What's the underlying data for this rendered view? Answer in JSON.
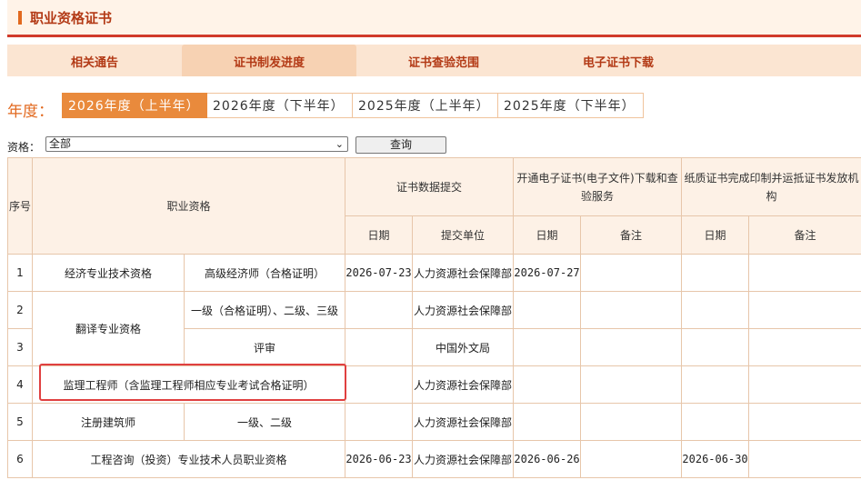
{
  "page": {
    "title": "职业资格证书"
  },
  "tabs": [
    {
      "label": "相关通告"
    },
    {
      "label": "证书制发进度"
    },
    {
      "label": "证书查验范围"
    },
    {
      "label": "电子证书下载"
    }
  ],
  "year": {
    "label": "年度：",
    "options": [
      {
        "label": "2026年度（上半年）"
      },
      {
        "label": "2026年度（下半年）"
      },
      {
        "label": "2025年度（上半年）"
      },
      {
        "label": "2025年度（下半年）"
      }
    ]
  },
  "filter": {
    "label": "资格：",
    "selected": "全部",
    "query_label": "查询"
  },
  "table": {
    "headers": {
      "seq": "序号",
      "qualification": "职业资格",
      "submission": "证书数据提交",
      "electronic": "开通电子证书(电子文件)下载和查验服务",
      "paper": "纸质证书完成印制并运抵证书发放机构",
      "date": "日期",
      "unit": "提交单位",
      "note": "备注"
    },
    "rows": [
      {
        "seq": "1",
        "group": "经济专业技术资格",
        "sub": "高级经济师（合格证明）",
        "submit_date": "2026-07-23",
        "unit": "人力资源社会保障部",
        "e_date": "2026-07-27",
        "e_note": "",
        "p_date": "",
        "p_note": ""
      },
      {
        "seq": "2",
        "group": "翻译专业资格",
        "sub": "一级（合格证明）、二级、三级",
        "submit_date": "",
        "unit": "人力资源社会保障部",
        "e_date": "",
        "e_note": "",
        "p_date": "",
        "p_note": ""
      },
      {
        "seq": "3",
        "sub": "评审",
        "submit_date": "",
        "unit": "中国外文局",
        "e_date": "",
        "e_note": "",
        "p_date": "",
        "p_note": ""
      },
      {
        "seq": "4",
        "full": "监理工程师（含监理工程师相应专业考试合格证明）",
        "submit_date": "",
        "unit": "人力资源社会保障部",
        "e_date": "",
        "e_note": "",
        "p_date": "",
        "p_note": ""
      },
      {
        "seq": "5",
        "group": "注册建筑师",
        "sub": "一级、二级",
        "submit_date": "",
        "unit": "人力资源社会保障部",
        "e_date": "",
        "e_note": "",
        "p_date": "",
        "p_note": ""
      },
      {
        "seq": "6",
        "full": "工程咨询（投资）专业技术人员职业资格",
        "submit_date": "2026-06-23",
        "unit": "人力资源社会保障部",
        "e_date": "2026-06-26",
        "e_note": "",
        "p_date": "2026-06-30",
        "p_note": ""
      }
    ]
  }
}
